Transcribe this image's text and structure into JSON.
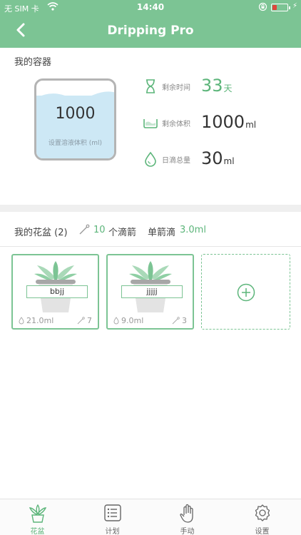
{
  "status_bar": {
    "carrier": "无 SIM 卡",
    "time": "14:40"
  },
  "nav": {
    "title": "Dripping Pro"
  },
  "container": {
    "section_title": "我的容器",
    "tank_volume": "1000",
    "tank_hint": "设置溶液体积 (ml)",
    "stats": [
      {
        "icon": "hourglass-icon",
        "label": "剩余时间",
        "value": "33",
        "unit": "天"
      },
      {
        "icon": "container-icon",
        "label": "剩余体积",
        "value": "1000",
        "unit": "ml"
      },
      {
        "icon": "droplet-icon",
        "label": "日滴总量",
        "value": "30",
        "unit": "ml"
      }
    ]
  },
  "pots": {
    "title": "我的花盆 (2)",
    "arrow_count": "10",
    "arrow_label": "个滴箭",
    "single_label": "单箭滴",
    "single_value": "3.0ml",
    "cards": [
      {
        "name": "bbjj",
        "volume": "21.0ml",
        "count": "7"
      },
      {
        "name": "jjjjj",
        "volume": "9.0ml",
        "count": "3"
      }
    ]
  },
  "tabs": [
    {
      "label": "花盆",
      "icon": "plant-icon",
      "active": true
    },
    {
      "label": "计划",
      "icon": "plan-list-icon",
      "active": false
    },
    {
      "label": "手动",
      "icon": "hand-icon",
      "active": false
    },
    {
      "label": "设置",
      "icon": "gear-icon",
      "active": false
    }
  ],
  "colors": {
    "brand_green": "#7cc494",
    "accent_green": "#5cb57a",
    "water_blue": "#cde8f5"
  }
}
